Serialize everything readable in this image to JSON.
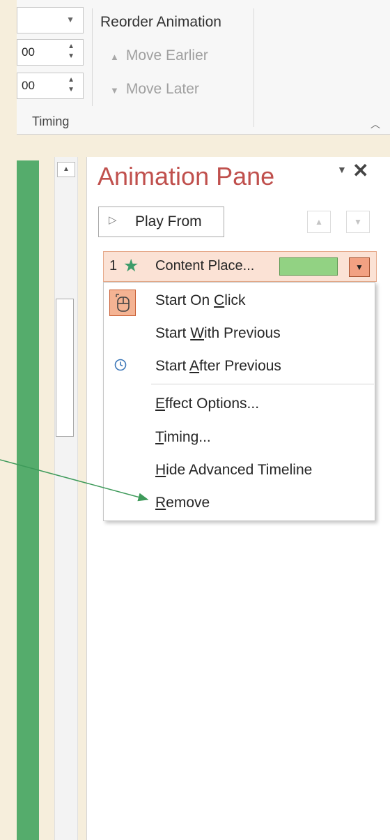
{
  "ribbon": {
    "spinners": [
      {
        "value": "00"
      },
      {
        "value": "00"
      }
    ],
    "reorder": {
      "title": "Reorder Animation",
      "move_earlier": "Move Earlier",
      "move_later": "Move Later"
    },
    "timing_label": "Timing"
  },
  "pane": {
    "title": "Animation Pane",
    "play_from": "Play From",
    "item": {
      "number": "1",
      "label": "Content Place...",
      "bar_color": "#92d283"
    }
  },
  "menu": {
    "items": [
      {
        "pre": "Start On ",
        "key": "C",
        "post": "lick",
        "icon": "mouse-click-icon"
      },
      {
        "pre": "Start ",
        "key": "W",
        "post": "ith Previous",
        "icon": ""
      },
      {
        "pre": "Start ",
        "key": "A",
        "post": "fter Previous",
        "icon": "clock-icon"
      },
      {
        "pre": "",
        "key": "E",
        "post": "ffect Options...",
        "icon": ""
      },
      {
        "pre": "",
        "key": "T",
        "post": "iming...",
        "icon": ""
      },
      {
        "pre": "",
        "key": "H",
        "post": "ide Advanced Timeline",
        "icon": ""
      },
      {
        "pre": "",
        "key": "R",
        "post": "emove",
        "icon": ""
      }
    ]
  },
  "colors": {
    "pane_title": "#c0504d",
    "annotation_arrow": "#3e9a5a",
    "slide_green": "#55ac6c",
    "highlight": "#fbe2d5"
  }
}
